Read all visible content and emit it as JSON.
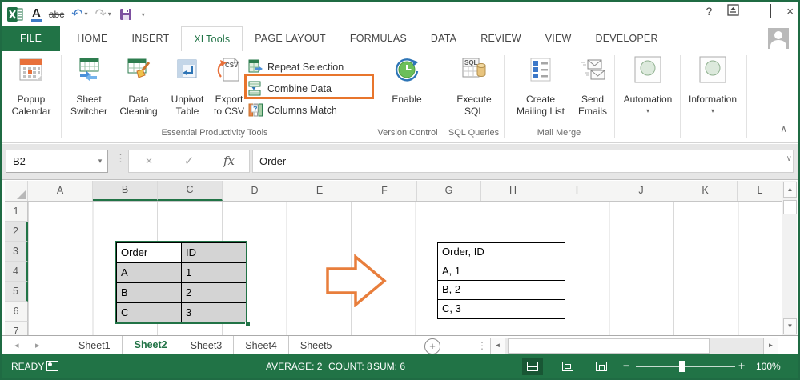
{
  "icons": {
    "dropdown": "▾",
    "dots": "⋮",
    "cancel": "×",
    "check": "✓",
    "undo": "↶",
    "redo": "↷",
    "help": "?",
    "close": "×",
    "up": "▲",
    "down": "▼",
    "left": "◄",
    "right": "►",
    "nav_left": "◂",
    "nav_right": "▸",
    "collapse": "∧",
    "expand": "∨",
    "plus": "+",
    "minus": "−"
  },
  "colors": {
    "accent": "#217346",
    "orange": "#E87E3C",
    "highlight": "#E8752C",
    "selection": "#D4D4D4"
  },
  "qat": {
    "font_color": "A",
    "strike": "abc"
  },
  "tabs": {
    "items": [
      "FILE",
      "HOME",
      "INSERT",
      "XLTools",
      "PAGE LAYOUT",
      "FORMULAS",
      "DATA",
      "REVIEW",
      "VIEW",
      "DEVELOPER"
    ]
  },
  "ribbon": {
    "group_labels": [
      "Essential Productivity Tools",
      "Version Control",
      "SQL Queries",
      "Mail Merge"
    ],
    "buttons": {
      "popup_calendar": [
        "Popup",
        "Calendar"
      ],
      "sheet_switcher": [
        "Sheet",
        "Switcher"
      ],
      "data_cleaning": [
        "Data",
        "Cleaning"
      ],
      "unpivot_table": [
        "Unpivot",
        "Table"
      ],
      "export_to_csv": [
        "Export",
        "to CSV"
      ],
      "repeat_selection": "Repeat Selection",
      "combine_data": "Combine Data",
      "columns_match": "Columns Match",
      "enable": "Enable",
      "execute_sql": [
        "Execute",
        "SQL"
      ],
      "create_mailing_list": [
        "Create",
        "Mailing List"
      ],
      "send_emails": [
        "Send",
        "Emails"
      ],
      "automation": "Automation",
      "information": "Information"
    },
    "icon_texts": {
      "csv": "CSV",
      "sql": "SQL",
      "question": "?"
    }
  },
  "formula_bar": {
    "name_box": "B2",
    "fx": "fx",
    "value": "Order"
  },
  "grid": {
    "columns": [
      "A",
      "B",
      "C",
      "D",
      "E",
      "F",
      "G",
      "H",
      "I",
      "J",
      "K",
      "L"
    ],
    "rows": [
      "1",
      "2",
      "3",
      "4",
      "5",
      "6",
      "7"
    ],
    "source_table": [
      [
        "Order",
        "ID"
      ],
      [
        "A",
        "1"
      ],
      [
        "B",
        "2"
      ],
      [
        "C",
        "3"
      ]
    ],
    "result_rows": [
      "Order, ID",
      "A, 1",
      "B, 2",
      "C, 3"
    ]
  },
  "sheet_bar": {
    "tabs": [
      "Sheet1",
      "Sheet2",
      "Sheet3",
      "Sheet4",
      "Sheet5"
    ]
  },
  "status_bar": {
    "mode": "READY",
    "average": "AVERAGE: 2",
    "count": "COUNT: 8",
    "sum": "SUM: 6",
    "zoom": "100%"
  }
}
